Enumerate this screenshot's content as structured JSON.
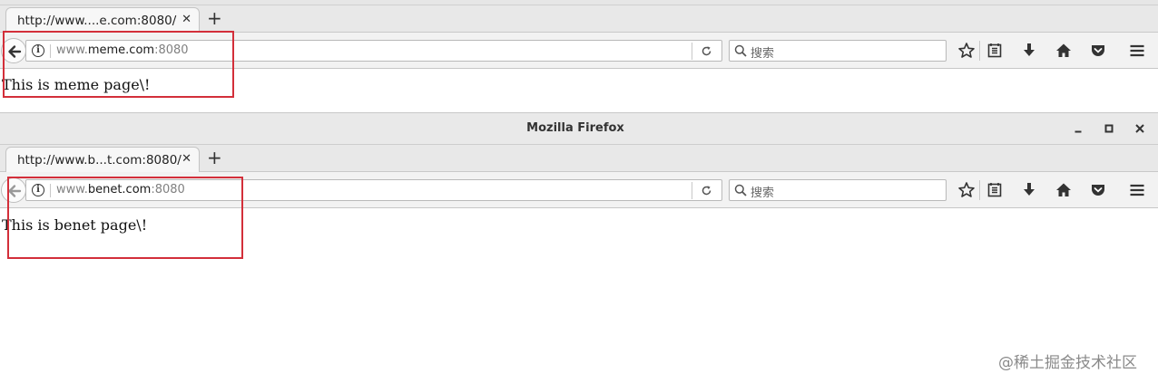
{
  "top_window": {
    "tab": {
      "title": "http://www....e.com:8080/",
      "close_glyph": "✕"
    },
    "new_tab_glyph": "+",
    "url": {
      "prefix": "www.",
      "host": "meme.com",
      "port": ":8080"
    },
    "search_placeholder": "搜索",
    "content": "This is meme page\\!"
  },
  "second_window": {
    "title": "Mozilla Firefox",
    "controls": {
      "minimize": "minimize",
      "maximize": "maximize",
      "close": "close"
    },
    "tab": {
      "title": "http://www.b...t.com:8080/",
      "close_glyph": "✕"
    },
    "new_tab_glyph": "+",
    "url": {
      "prefix": "www.",
      "host": "benet.com",
      "port": ":8080"
    },
    "search_placeholder": "搜索",
    "content": "This is benet page\\!"
  },
  "toolbar_icons": [
    "star-icon",
    "reading-list-icon",
    "download-icon",
    "home-icon",
    "pocket-icon",
    "menu-icon"
  ],
  "highlight_color": "#d32f3a",
  "watermark": "@稀土掘金技术社区"
}
